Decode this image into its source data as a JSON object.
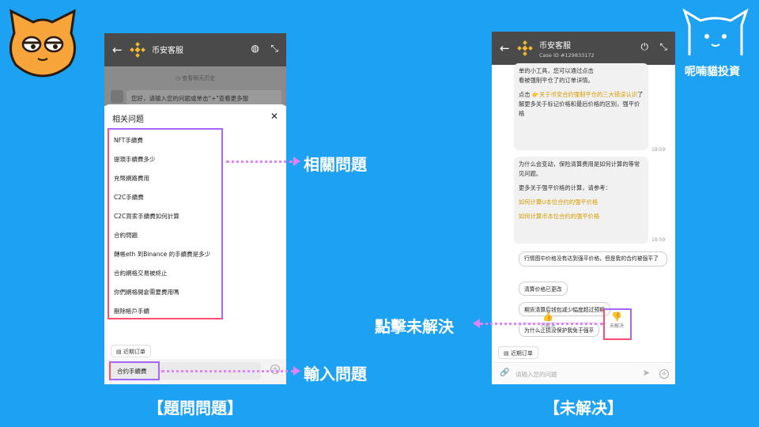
{
  "left_phone": {
    "back": "←",
    "title": "币安客服",
    "history": "◷ 查看聊天历史",
    "bot_message": "您好，请输入您的问题或单击\"+\"查看更多服",
    "sheet_title": "相关问题",
    "close": "✕",
    "questions": [
      "NFT手續費",
      "提現手續費多少",
      "充幣網路費用",
      "C2C手續費",
      "C2C買家手續費如何計算",
      "合約問題",
      "轉帳eth 到Binance 的手續費是多少",
      "合約網格交易被終止",
      "你們網格開倉需要費用嗎",
      "刪除帳戶手續"
    ],
    "recent_orders": "▤ 近期订单",
    "input_value": "合约手續費"
  },
  "right_phone": {
    "title": "币安客服",
    "case_id": "Case ID #129833172",
    "msg1_line1": "单的小工具，您可以通过点击",
    "msg1_line2": "看被强制平仓了的订单详情。",
    "msg1_link_text_pre": "点击 ",
    "msg1_link": "👉关于币安合约强制平仓的三大错误认识",
    "msg1_after": "了解更多关于标记价格和最后价格的区别，强平价格",
    "time1": "18:59",
    "msg2_p1": "为什么会变动，保险清算费用是如何计算的等常见问题。",
    "msg2_p2": "更多关于强平价格的计算，请参考：",
    "msg2_link1": "如何计算U本位合约的强平价格",
    "msg2_link2": "如何计算币本位合约的强平价格",
    "time2": "18:59",
    "chips": [
      "行情图中价格没有达到强平价格，但是我的合约被强平了",
      "清算价格已更改",
      "期货清算后钱包减少幅度超过预期",
      "为什么止损没保护我免于强平"
    ],
    "resolved": "已解决",
    "unresolved": "未解决",
    "recent_orders": "▤ 近期订单",
    "input_placeholder": "请输入您的问题"
  },
  "annotations": {
    "related": "相關問題",
    "input": "輸入問題",
    "click_unresolved": "點擊未解決",
    "caption_left": "【題問問題】",
    "caption_right": "【未解决】",
    "brand": "呢喃貓投資"
  },
  "colors": {
    "background": "#1da1f2",
    "topbar": "#4a4a4a",
    "highlight_purple": "#a566ff",
    "highlight_red": "#ff4d6d",
    "link": "#d69b00"
  }
}
